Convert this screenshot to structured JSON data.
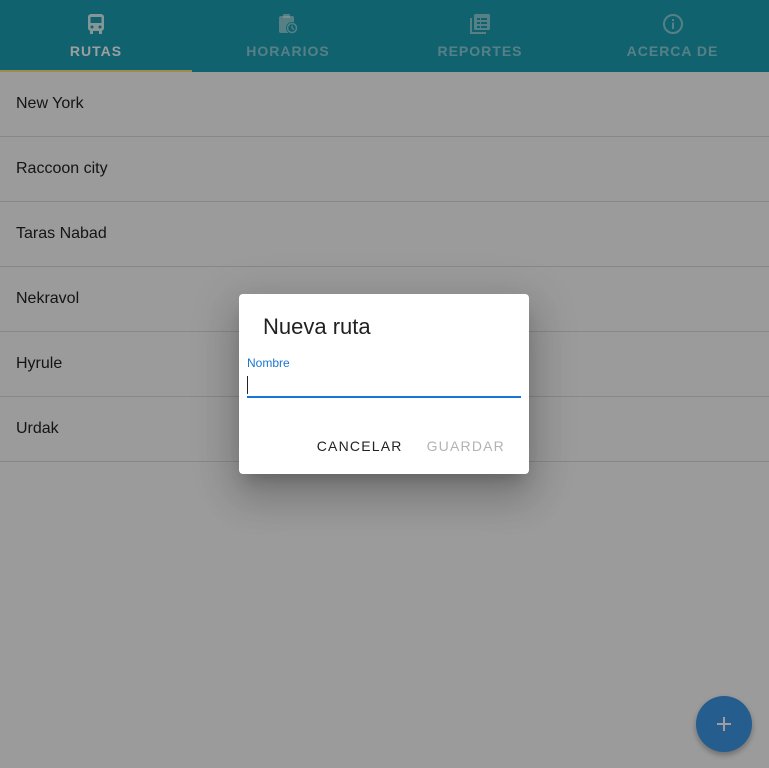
{
  "tabs": [
    {
      "label": "RUTAS",
      "icon": "bus-icon",
      "active": true
    },
    {
      "label": "HORARIOS",
      "icon": "schedule-icon",
      "active": false
    },
    {
      "label": "REPORTES",
      "icon": "reports-icon",
      "active": false
    },
    {
      "label": "ACERCA DE",
      "icon": "info-icon",
      "active": false
    }
  ],
  "routes": [
    {
      "name": "New York"
    },
    {
      "name": "Raccoon city"
    },
    {
      "name": "Taras Nabad"
    },
    {
      "name": "Nekravol"
    },
    {
      "name": "Hyrule"
    },
    {
      "name": "Urdak"
    }
  ],
  "dialog": {
    "title": "Nueva ruta",
    "field_label": "Nombre",
    "field_value": "",
    "cancel_label": "CANCELAR",
    "save_label": "GUARDAR"
  },
  "fab": {
    "icon": "plus-icon"
  },
  "colors": {
    "header": "#1a9fb3",
    "indicator": "#ffe082",
    "accent": "#1976d2",
    "fab": "#3a96e6"
  }
}
